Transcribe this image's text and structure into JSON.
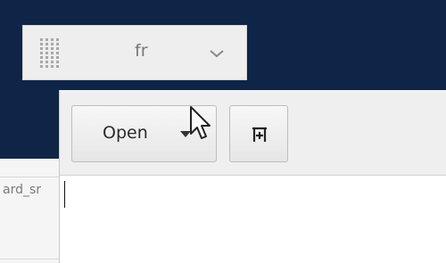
{
  "keyboard_indicator": {
    "language": "fr",
    "icon": "grip-icon",
    "dropdown_icon": "chevron-down-icon"
  },
  "left_panel": {
    "text": "ard_sr"
  },
  "toolbar": {
    "open_label": "Open",
    "open_dropdown_icon": "triangle-down-icon",
    "add_icon": "add-bookmark-icon"
  },
  "colors": {
    "desktop_background": "#0f2547",
    "panel_background": "#eeeeee",
    "toolbar_background": "#efefef"
  }
}
